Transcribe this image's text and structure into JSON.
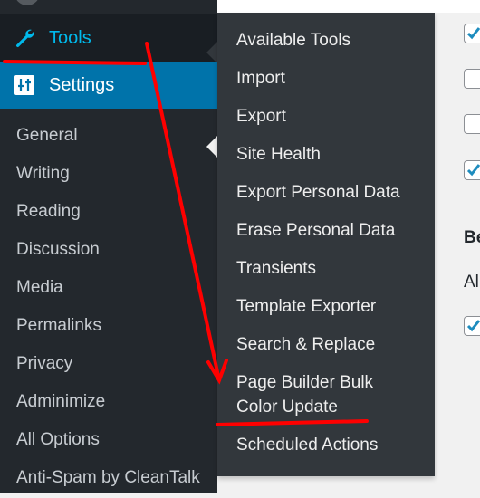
{
  "menu": {
    "tools": {
      "label": "Tools",
      "icon": "wrench-icon"
    },
    "settings": {
      "label": "Settings",
      "icon": "settings-sliders-icon"
    },
    "settings_submenu": [
      "General",
      "Writing",
      "Reading",
      "Discussion",
      "Media",
      "Permalinks",
      "Privacy",
      "Adminimize",
      "All Options",
      "Anti-Spam by CleanTalk"
    ]
  },
  "tools_flyout": [
    "Available Tools",
    "Import",
    "Export",
    "Site Health",
    "Export Personal Data",
    "Erase Personal Data",
    "Transients",
    "Template Exporter",
    "Search & Replace",
    "Page Builder Bulk Color Update",
    "Scheduled Actions"
  ],
  "content": {
    "heading_partial": "Be",
    "text_partial": "Al",
    "checkboxes": [
      true,
      false,
      false,
      true,
      true
    ]
  },
  "colors": {
    "sidebar": "#23282d",
    "active": "#0073aa",
    "flyout": "#32373c",
    "highlight": "#00b9eb",
    "annotation": "#ff0000"
  }
}
